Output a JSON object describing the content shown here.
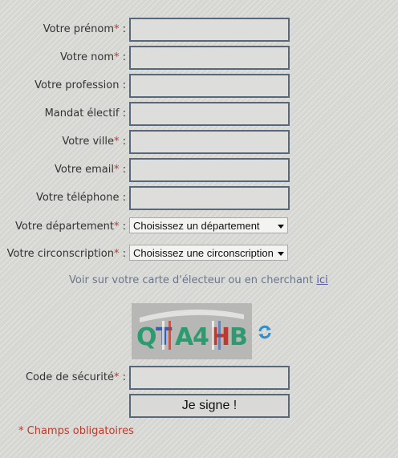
{
  "form": {
    "required_mark": "*",
    "colon": " :",
    "fields": [
      {
        "label": "Votre prénom",
        "required": true,
        "value": ""
      },
      {
        "label": "Votre nom",
        "required": true,
        "value": ""
      },
      {
        "label": "Votre profession",
        "required": false,
        "value": ""
      },
      {
        "label": "Mandat électif",
        "required": false,
        "value": ""
      },
      {
        "label": "Votre ville",
        "required": true,
        "value": ""
      },
      {
        "label": "Votre email",
        "required": true,
        "value": ""
      },
      {
        "label": "Votre téléphone",
        "required": false,
        "value": ""
      }
    ],
    "department": {
      "label": "Votre département",
      "selected": "Choisissez un département"
    },
    "circonscription": {
      "label": "Votre circonscription",
      "selected": "Choisissez une circonscription"
    },
    "hint": {
      "text": "Voir sur votre carte d'électeur ou en cherchant ",
      "link": "ici"
    },
    "captcha": {
      "text": "QTA4HB",
      "refresh_icon": "refresh-icon"
    },
    "security_code": {
      "label": "Code de sécurité",
      "value": ""
    },
    "submit_label": "Je signe !",
    "footnote": "* Champs obligatoires"
  },
  "colors": {
    "background": "#d6d6d3",
    "input_border": "#56687a",
    "required": "#c0392b",
    "hint": "#6a7788"
  }
}
